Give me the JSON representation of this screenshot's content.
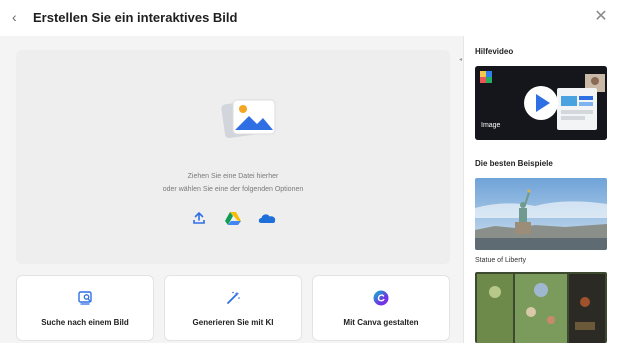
{
  "header": {
    "title": "Erstellen Sie ein interaktives Bild",
    "back_icon": "chevron-left",
    "close_icon": "close-x"
  },
  "dropzone": {
    "line1": "Ziehen Sie eine Datei hierher",
    "line2": "oder wählen Sie eine der folgenden Optionen",
    "sources": [
      "upload-icon",
      "google-drive-icon",
      "onedrive-icon"
    ]
  },
  "cards": [
    {
      "label": "Suche nach einem Bild",
      "icon": "image-search-icon"
    },
    {
      "label": "Generieren Sie mit KI",
      "icon": "magic-wand-icon"
    },
    {
      "label": "Mit Canva gestalten",
      "icon": "canva-icon"
    }
  ],
  "sidebar": {
    "video_heading": "Hilfevideo",
    "video_label": "Image",
    "examples_heading": "Die besten Beispiele",
    "examples": [
      {
        "caption": "Statue of Liberty"
      },
      {
        "caption": ""
      }
    ]
  },
  "colors": {
    "accent": "#2f6fe4",
    "card_border": "#e3e3e3",
    "canvas": "#f4f4f5"
  }
}
